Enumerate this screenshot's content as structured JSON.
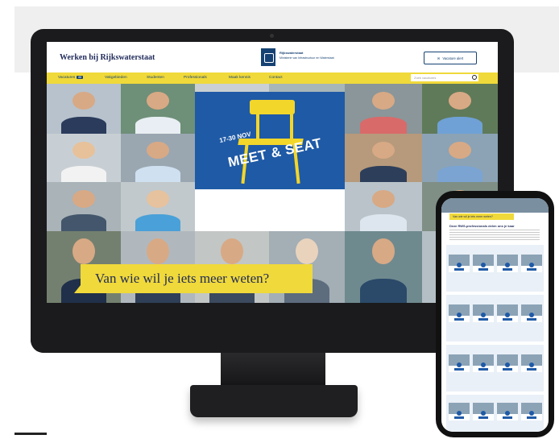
{
  "site": {
    "title": "Werken bij Rijkswaterstaat",
    "logo_line1": "Rijkswaterstaat",
    "logo_line2": "Ministerie van Infrastructuur en Waterstaat",
    "alert_label": "Vacature alert"
  },
  "nav": {
    "items": [
      {
        "label": "Vacatures",
        "badge": "88"
      },
      {
        "label": "Vakgebieden"
      },
      {
        "label": "Studenten"
      },
      {
        "label": "Professionals"
      },
      {
        "label": "Maak kennis"
      },
      {
        "label": "Contact"
      }
    ],
    "search_placeholder": "Zoek vacatures"
  },
  "feature": {
    "date": "17-30 NOV",
    "title": "MEET & SEAT"
  },
  "banner": {
    "question": "Van wie wil je iets meer weten?"
  },
  "phone": {
    "banner": "Van wie wil je iets meer weten?",
    "heading": "Deze RWS-professionals delen ons je kaar"
  },
  "colors": {
    "brand_blue": "#154273",
    "accent_yellow": "#f0d93a",
    "feature_blue": "#1f5aa6"
  }
}
